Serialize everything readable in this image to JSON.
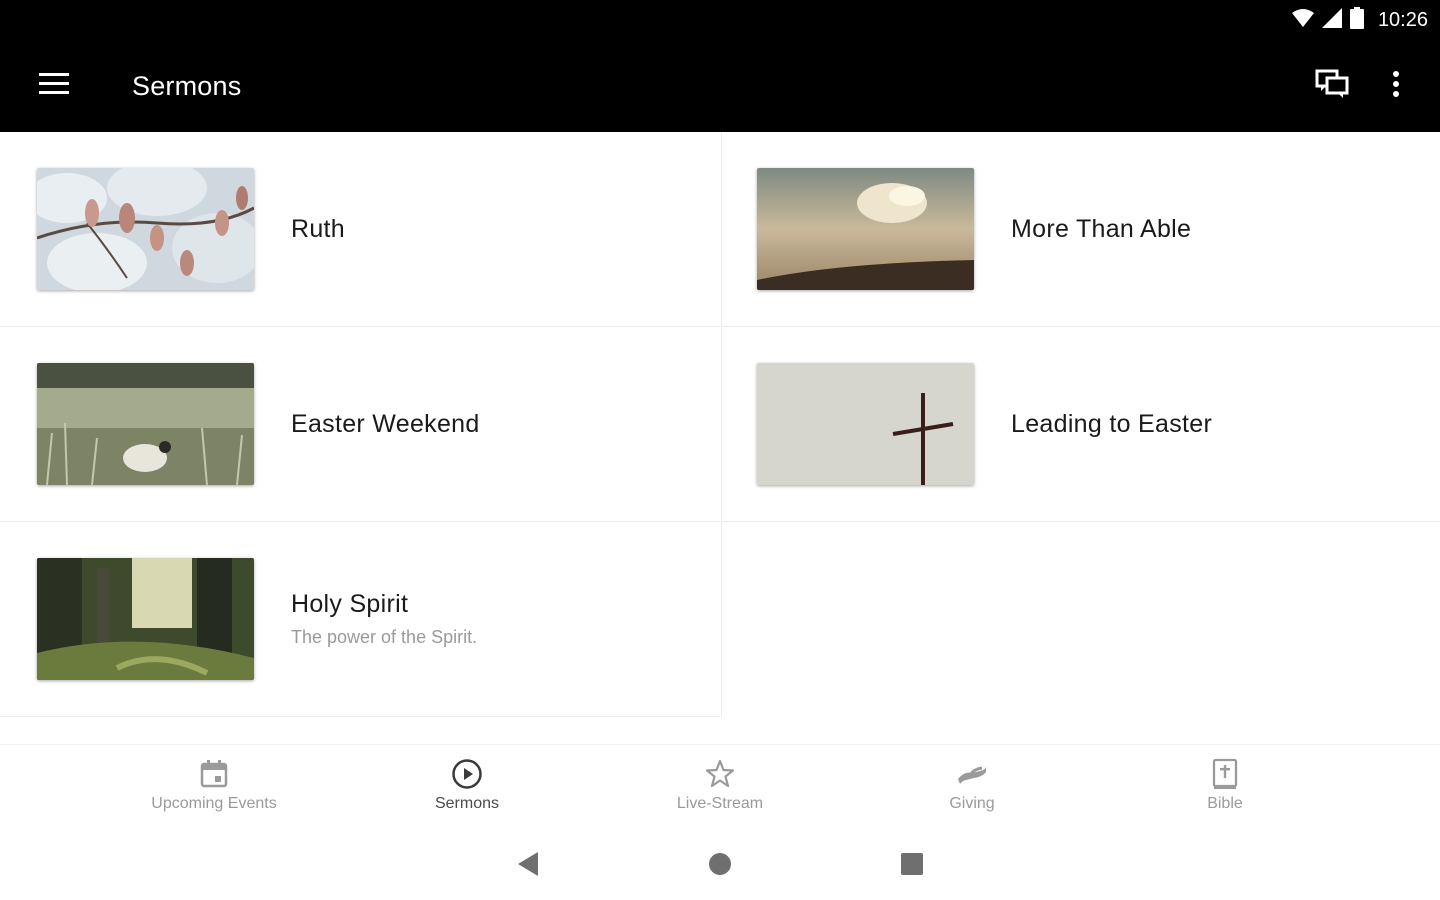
{
  "status_bar": {
    "time": "10:26"
  },
  "app_bar": {
    "title": "Sermons"
  },
  "sermons": [
    {
      "title": "Ruth",
      "subtitle": ""
    },
    {
      "title": "More Than Able",
      "subtitle": ""
    },
    {
      "title": "Easter Weekend",
      "subtitle": ""
    },
    {
      "title": "Leading to Easter",
      "subtitle": ""
    },
    {
      "title": "Holy Spirit",
      "subtitle": "The power of the Spirit."
    }
  ],
  "bottom_nav": {
    "items": [
      {
        "label": "Upcoming Events",
        "icon": "calendar-icon"
      },
      {
        "label": "Sermons",
        "icon": "play-circle-icon",
        "active": true
      },
      {
        "label": "Live-Stream",
        "icon": "star-icon"
      },
      {
        "label": "Giving",
        "icon": "giving-hand-icon"
      },
      {
        "label": "Bible",
        "icon": "bible-icon"
      }
    ]
  },
  "colors": {
    "app_bar_bg": "#000000",
    "inactive_nav": "#9a9a9a",
    "active_nav": "#4a4a4a"
  }
}
